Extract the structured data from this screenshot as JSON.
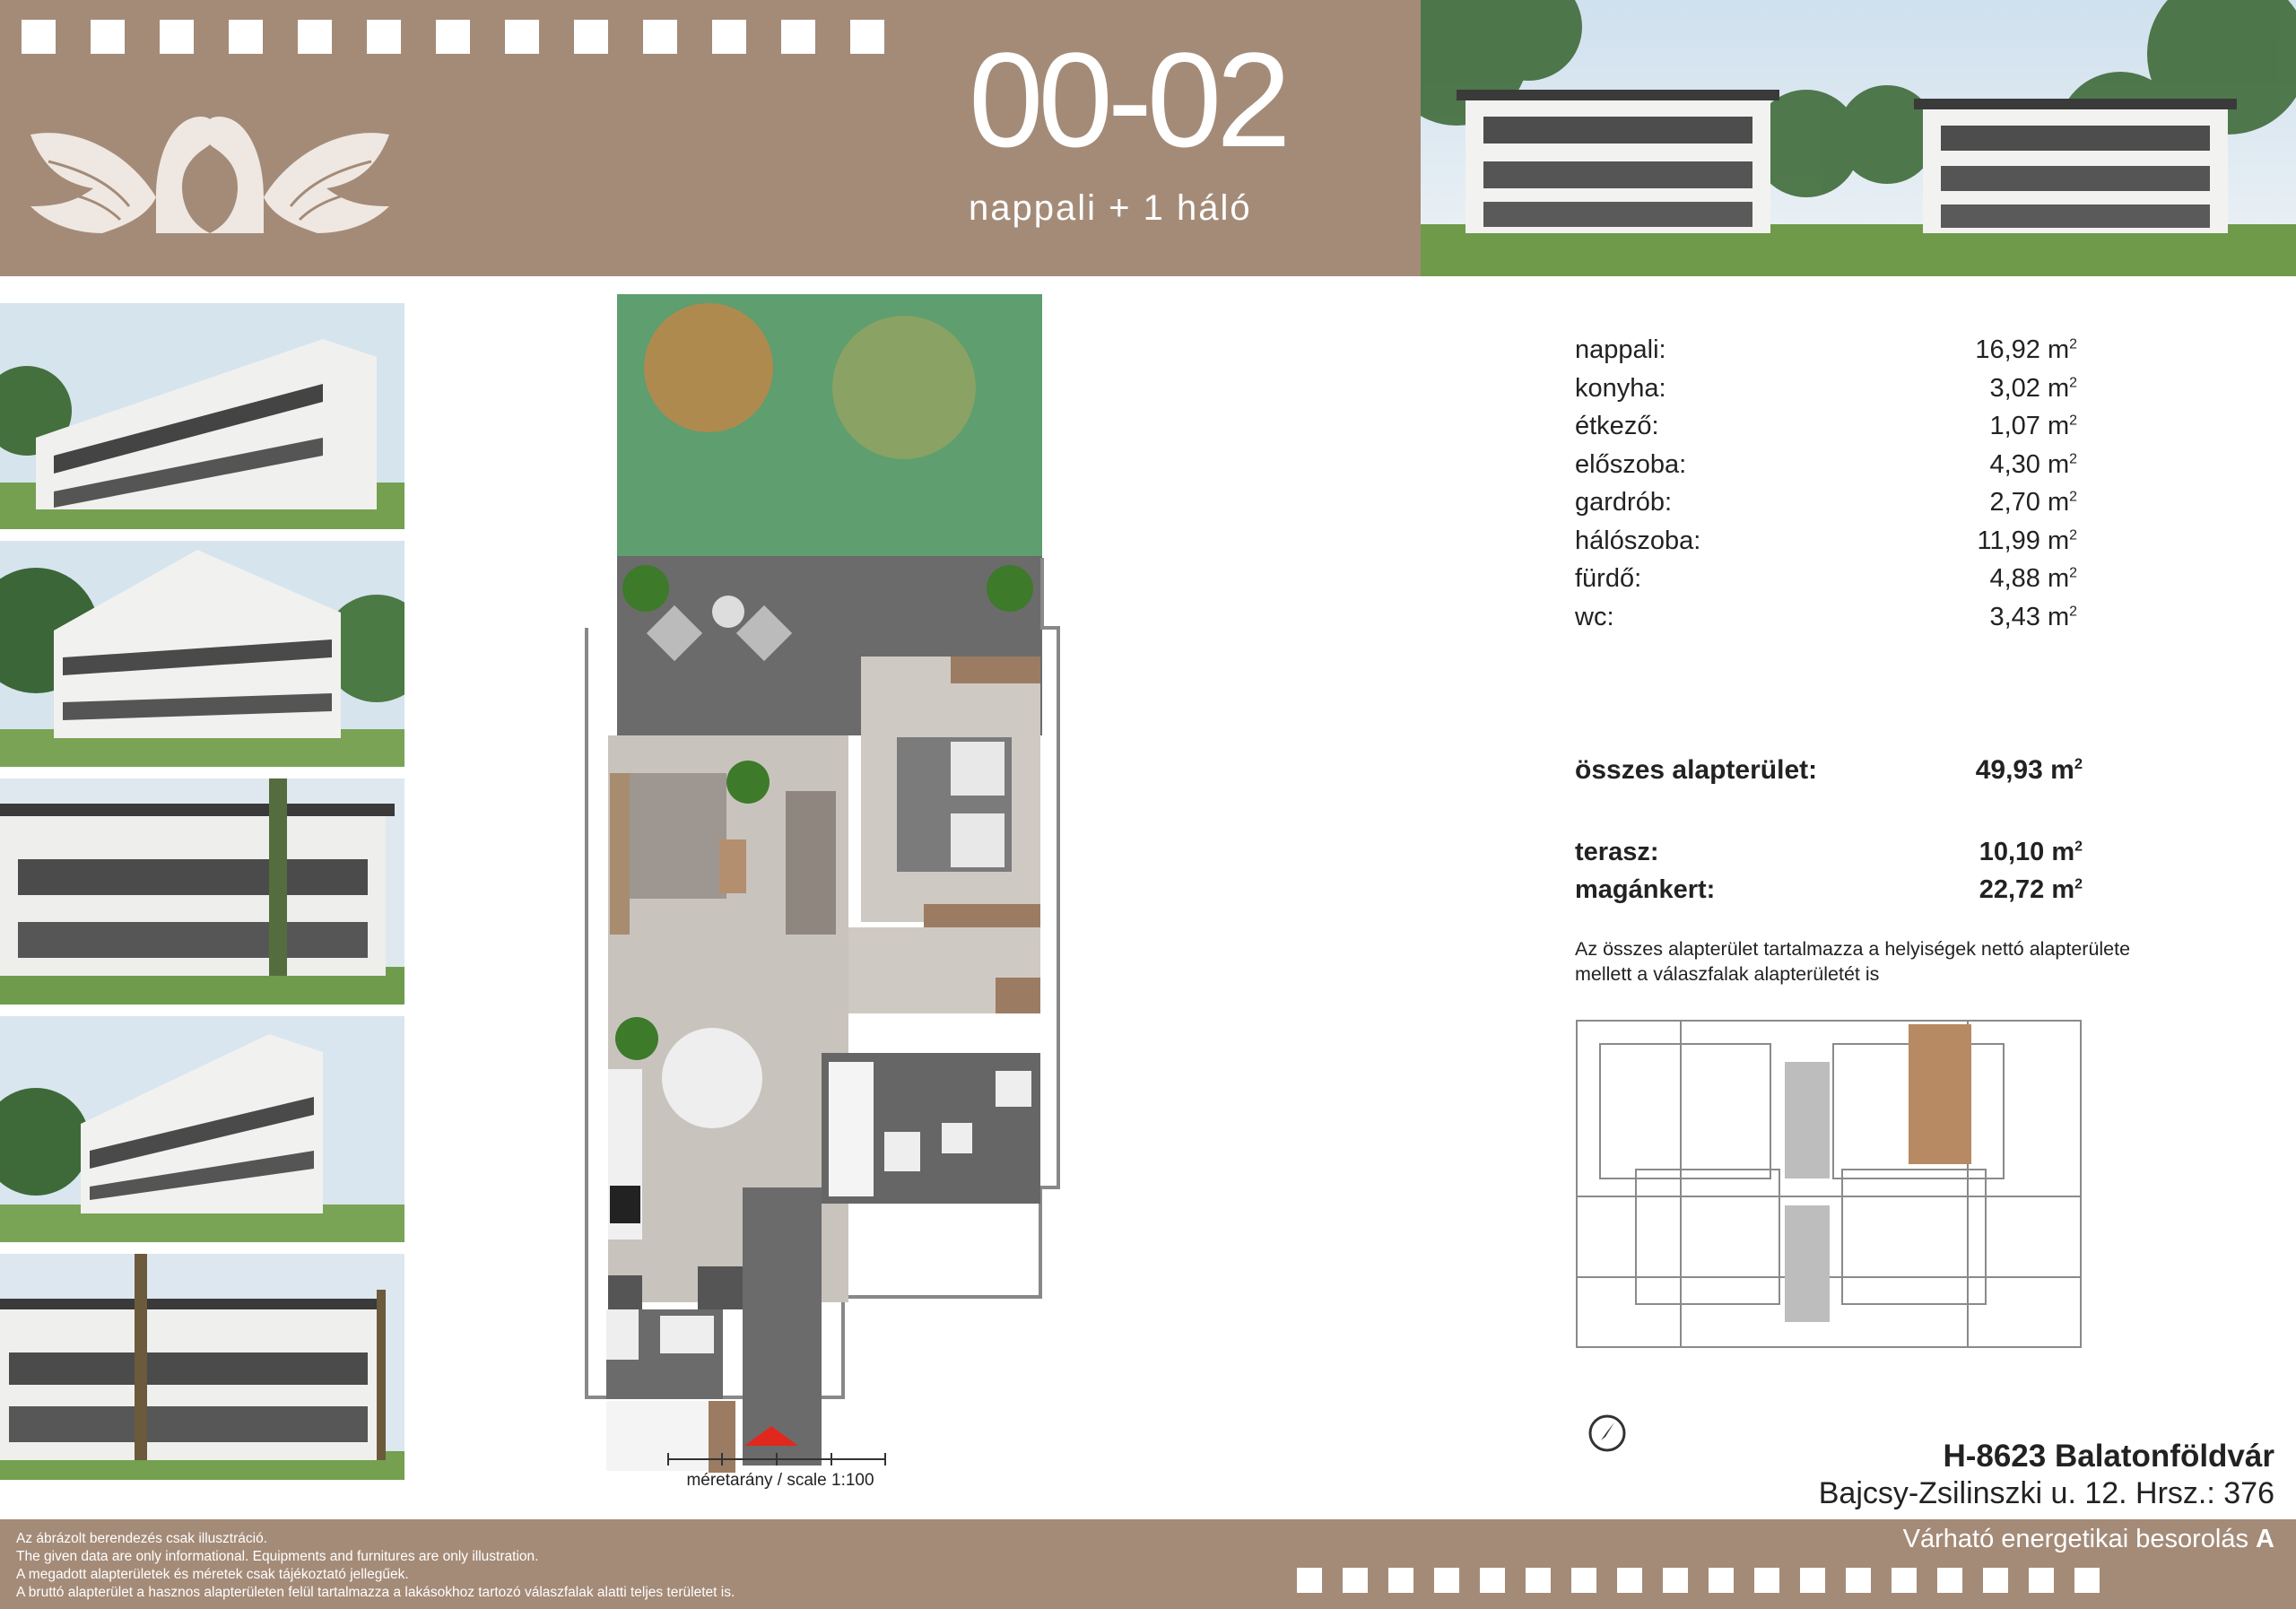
{
  "unit": {
    "code": "00-02",
    "subtitle": "nappali + 1 háló"
  },
  "areas": [
    {
      "label": "nappali:",
      "value": "16,92 m",
      "unit_sup": "2"
    },
    {
      "label": "konyha:",
      "value": "3,02 m",
      "unit_sup": "2"
    },
    {
      "label": "étkező:",
      "value": "1,07 m",
      "unit_sup": "2"
    },
    {
      "label": "előszoba:",
      "value": "4,30 m",
      "unit_sup": "2"
    },
    {
      "label": "gardrób:",
      "value": "2,70 m",
      "unit_sup": "2"
    },
    {
      "label": "hálószoba:",
      "value": "11,99 m",
      "unit_sup": "2"
    },
    {
      "label": "fürdő:",
      "value": "4,88 m",
      "unit_sup": "2"
    },
    {
      "label": "wc:",
      "value": "3,43 m",
      "unit_sup": "2"
    }
  ],
  "total": {
    "label": "összes alapterület:",
    "value": "49,93 m",
    "unit_sup": "2"
  },
  "extras": [
    {
      "label": "terasz:",
      "value": "10,10 m",
      "unit_sup": "2"
    },
    {
      "label": "magánkert:",
      "value": "22,72 m",
      "unit_sup": "2"
    }
  ],
  "note": "Az összes alapterület tartalmazza a helyiségek nettó alapterülete mellett a válaszfalak alapterületét is",
  "scale": "méretarány / scale 1:100",
  "address": {
    "line1": "H-8623 Balatonföldvár",
    "line2": "Bajcsy-Zsilinszki u. 12. Hrsz.: 376"
  },
  "energy": {
    "text": "Várható energetikai besorolás",
    "class": "A"
  },
  "disclaimer": [
    "Az ábrázolt berendezés csak illusztráció.",
    "The given data are only informational. Equipments and furnitures are only illustration.",
    "A megadott alapterületek és méretek csak tájékoztató jellegűek.",
    "A bruttó alapterület a hasznos alapterületen felül tartalmazza a lakásokhoz tartozó válaszfalak alatti teljes területet is."
  ],
  "colors": {
    "band": "#a48b78",
    "highlight_unit": "#b88a63",
    "arrow": "#e0281e"
  },
  "icons": [
    "swan-logo",
    "compass-icon",
    "north-arrow-icon"
  ]
}
